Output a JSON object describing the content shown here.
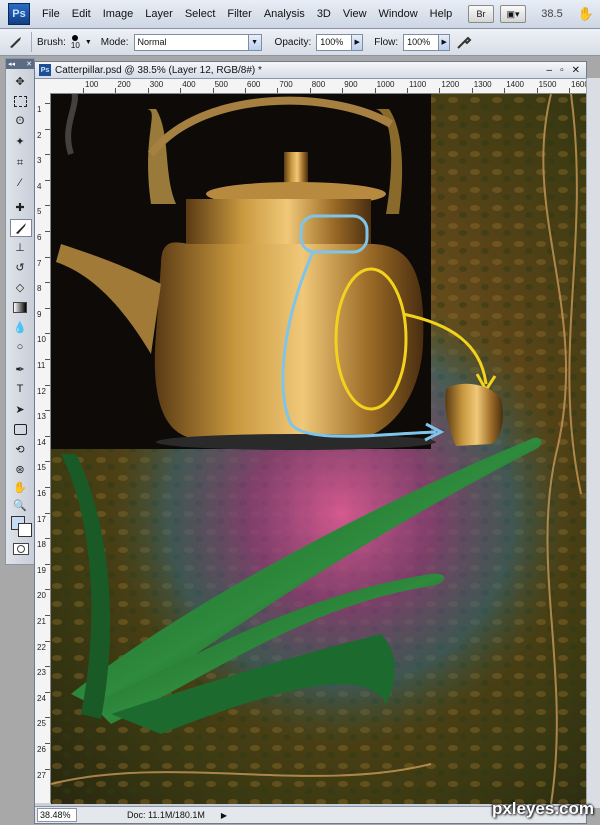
{
  "menubar": {
    "logo": "Ps",
    "items": [
      "File",
      "Edit",
      "Image",
      "Layer",
      "Select",
      "Filter",
      "Analysis",
      "3D",
      "View",
      "Window",
      "Help"
    ],
    "bridge_label": "Br",
    "zoom_value": "38.5"
  },
  "options": {
    "brush_label": "Brush:",
    "brush_size": "10",
    "mode_label": "Mode:",
    "mode_value": "Normal",
    "opacity_label": "Opacity:",
    "opacity_value": "100%",
    "flow_label": "Flow:",
    "flow_value": "100%"
  },
  "document": {
    "title": "Catterpillar.psd @ 38.5% (Layer 12, RGB/8#) *",
    "ruler_labels": [
      "100",
      "200",
      "300",
      "400",
      "500",
      "600",
      "700",
      "800",
      "900",
      "1000",
      "1100",
      "1200",
      "1300",
      "1400",
      "1500",
      "1600"
    ],
    "vruler_labels": [
      "1",
      "2",
      "3",
      "4",
      "5",
      "6",
      "7",
      "8",
      "9",
      "10",
      "11",
      "12",
      "13",
      "14",
      "15",
      "16",
      "17",
      "18",
      "19",
      "20",
      "21",
      "22",
      "23",
      "24",
      "25",
      "26",
      "27"
    ]
  },
  "status": {
    "zoom": "38.48%",
    "doc_size": "Doc: 11.1M/180.1M"
  },
  "watermark": "pxleyes.com",
  "colors": {
    "accent": "#1c4f98",
    "annotation_blue": "#7fc4ea",
    "annotation_yellow": "#f2d21c",
    "foreground_swatch": "#c8dcf4"
  }
}
